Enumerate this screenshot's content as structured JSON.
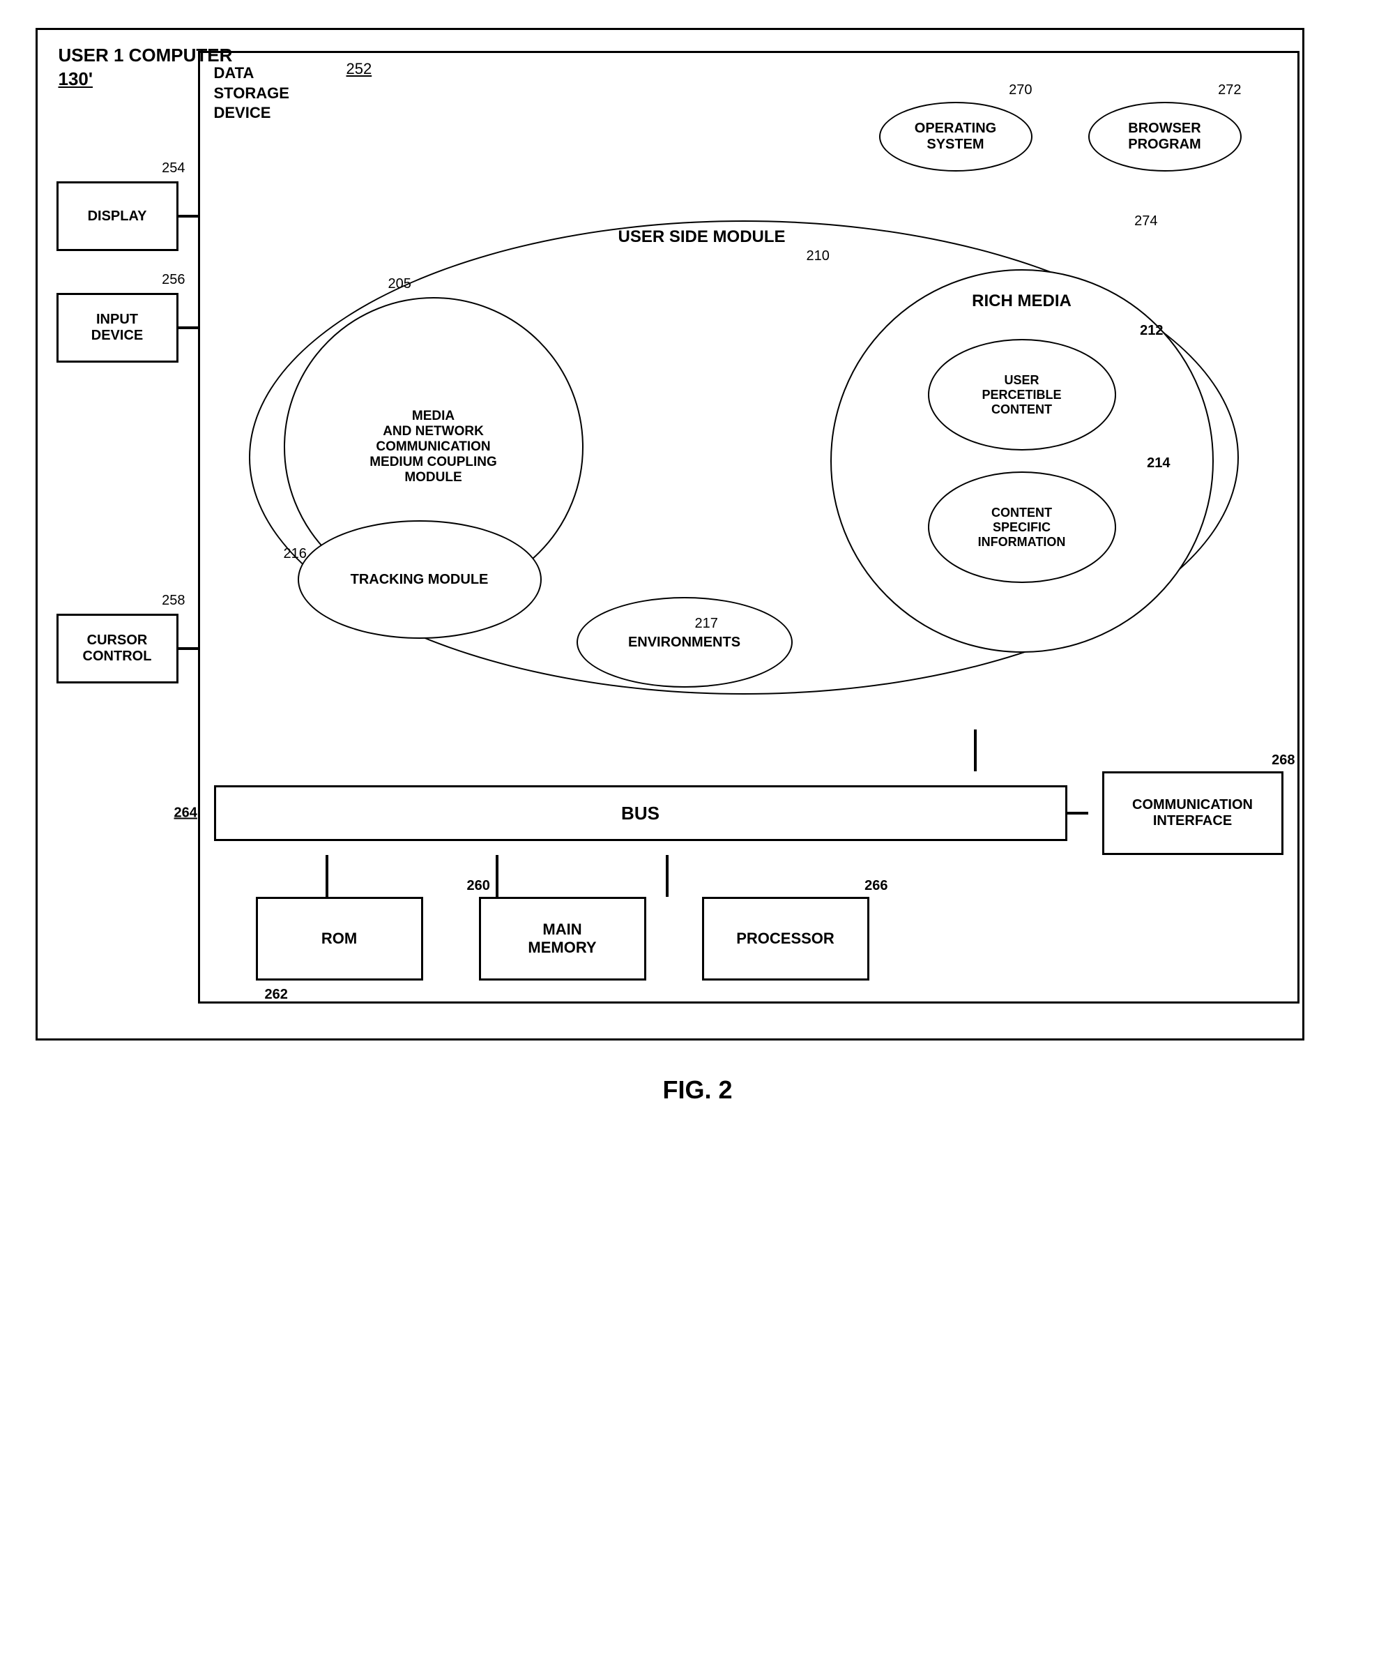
{
  "diagram": {
    "title": "USER 1 COMPUTER",
    "title_ref": "130'",
    "data_storage": {
      "label": "DATA\nSTORAGE\nDEVICE",
      "ref": "252"
    },
    "operating_system": {
      "label": "OPERATING\nSYSTEM",
      "ref": "270"
    },
    "browser_program": {
      "label": "BROWSER\nPROGRAM",
      "ref": "272"
    },
    "user_side_module": {
      "label": "USER SIDE MODULE",
      "ref": "274"
    },
    "media_network": {
      "label": "MEDIA\nAND NETWORK\nCOMMUNICATION\nMEDIUM COUPLING\nMODULE",
      "ref": "205"
    },
    "rich_media": {
      "label": "RICH MEDIA",
      "ref": "210"
    },
    "user_percep": {
      "label": "USER\nPERCETIBLE\nCONTENT",
      "ref": "212"
    },
    "content_specific": {
      "label": "CONTENT\nSPECIFIC\nINFORMATION",
      "ref": "214"
    },
    "tracking_module": {
      "label": "TRACKING MODULE",
      "ref": "216"
    },
    "environments": {
      "label": "ENVIRONMENTS",
      "ref": "217"
    },
    "bus": {
      "label": "BUS",
      "ref": "264"
    },
    "comm_interface": {
      "label": "COMMUNICATION\nINTERFACE",
      "ref": "268"
    },
    "display": {
      "label": "DISPLAY",
      "ref": "254"
    },
    "input_device": {
      "label": "INPUT\nDEVICE",
      "ref": "256"
    },
    "cursor_control": {
      "label": "CURSOR\nCONTROL",
      "ref": "258"
    },
    "rom": {
      "label": "ROM",
      "ref": "262"
    },
    "main_memory": {
      "label": "MAIN\nMEMORY",
      "ref": "260"
    },
    "processor": {
      "label": "PROCESSOR",
      "ref": "266"
    },
    "figure_caption": "FIG. 2"
  }
}
